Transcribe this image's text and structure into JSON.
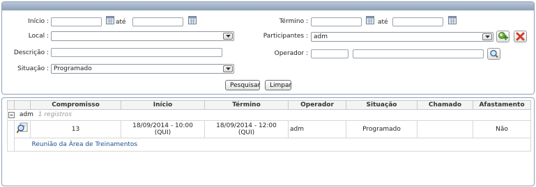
{
  "filters": {
    "inicio_label": "Início :",
    "ate_label": "até",
    "termino_label": "Término :",
    "local_label": "Local :",
    "participantes_label": "Participantes :",
    "participantes_value": "adm",
    "descricao_label": "Descrição :",
    "operador_label": "Operador :",
    "situacao_label": "Situação :",
    "situacao_value": "Programado",
    "pesquisar_label": "Pesquisar",
    "limpar_label": "Limpar"
  },
  "table": {
    "headers": [
      "Compromisso",
      "Início",
      "Término",
      "Operador",
      "Situação",
      "Chamado",
      "Afastamento"
    ],
    "group": {
      "name": "adm",
      "count": "1 registros"
    },
    "row": {
      "compromisso": "13",
      "inicio_1": "18/09/2014 - 10:00",
      "inicio_2": "(QUI)",
      "termino_1": "18/09/2014 - 12:00",
      "termino_2": "(QUI)",
      "operador": "adm",
      "situacao": "Programado",
      "chamado": "",
      "afastamento": "Não"
    },
    "description": "Reunião da Área de Treinamentos"
  },
  "icons": {
    "calendar": "calendar-icon",
    "add_participant": "add-user-icon",
    "remove_participant": "delete-icon",
    "search_operator": "magnifier-icon",
    "view_row": "magnifier-document-icon",
    "collapse": "minus-box-icon"
  }
}
